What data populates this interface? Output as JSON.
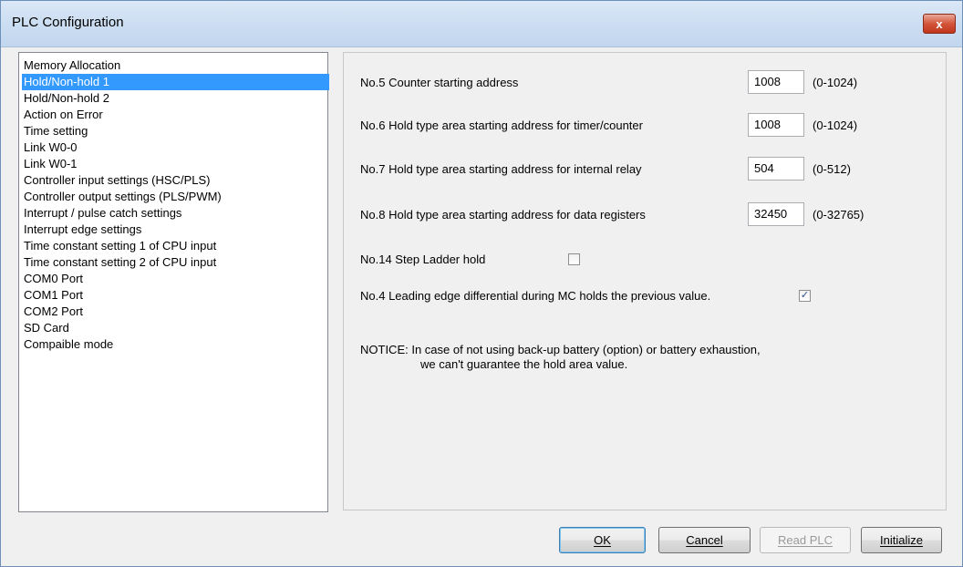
{
  "window": {
    "title": "PLC Configuration",
    "close_label": "x"
  },
  "sidebar": {
    "items": [
      {
        "label": "Memory Allocation"
      },
      {
        "label": "Hold/Non-hold 1"
      },
      {
        "label": "Hold/Non-hold 2"
      },
      {
        "label": "Action on Error"
      },
      {
        "label": "Time setting"
      },
      {
        "label": "Link W0-0"
      },
      {
        "label": "Link W0-1"
      },
      {
        "label": "Controller input settings (HSC/PLS)"
      },
      {
        "label": "Controller output settings (PLS/PWM)"
      },
      {
        "label": "Interrupt / pulse catch settings"
      },
      {
        "label": "Interrupt edge settings"
      },
      {
        "label": "Time constant setting 1 of CPU input"
      },
      {
        "label": "Time constant setting 2 of CPU input"
      },
      {
        "label": "COM0 Port"
      },
      {
        "label": "COM1 Port"
      },
      {
        "label": "COM2 Port"
      },
      {
        "label": "SD Card"
      },
      {
        "label": "Compaible mode"
      }
    ],
    "selected_label": "Hold/Non-hold 1"
  },
  "settings": {
    "rows": [
      {
        "label": "No.5 Counter starting address",
        "value": "1008",
        "range": "(0-1024)"
      },
      {
        "label": "No.6 Hold type area starting address for timer/counter",
        "value": "1008",
        "range": "(0-1024)"
      },
      {
        "label": "No.7 Hold type area starting address for internal relay",
        "value": "504",
        "range": "(0-512)"
      },
      {
        "label": "No.8 Hold type area starting address for data registers",
        "value": "32450",
        "range": "(0-32765)"
      }
    ],
    "step_ladder": {
      "label": "No.14 Step Ladder hold",
      "checked": false
    },
    "mc_hold": {
      "label": "No.4 Leading edge differential during MC holds the previous value.",
      "checked": true,
      "check_glyph": "✓"
    },
    "notice": {
      "line1": "NOTICE: In case of not using back-up battery (option) or battery exhaustion,",
      "line2": "we can't guarantee the hold area value."
    }
  },
  "buttons": {
    "ok": "OK",
    "cancel": "Cancel",
    "read_plc": "Read PLC",
    "initialize": "Initialize"
  },
  "colors": {
    "selection": "#3399ff",
    "close_button": "#c7432a"
  }
}
